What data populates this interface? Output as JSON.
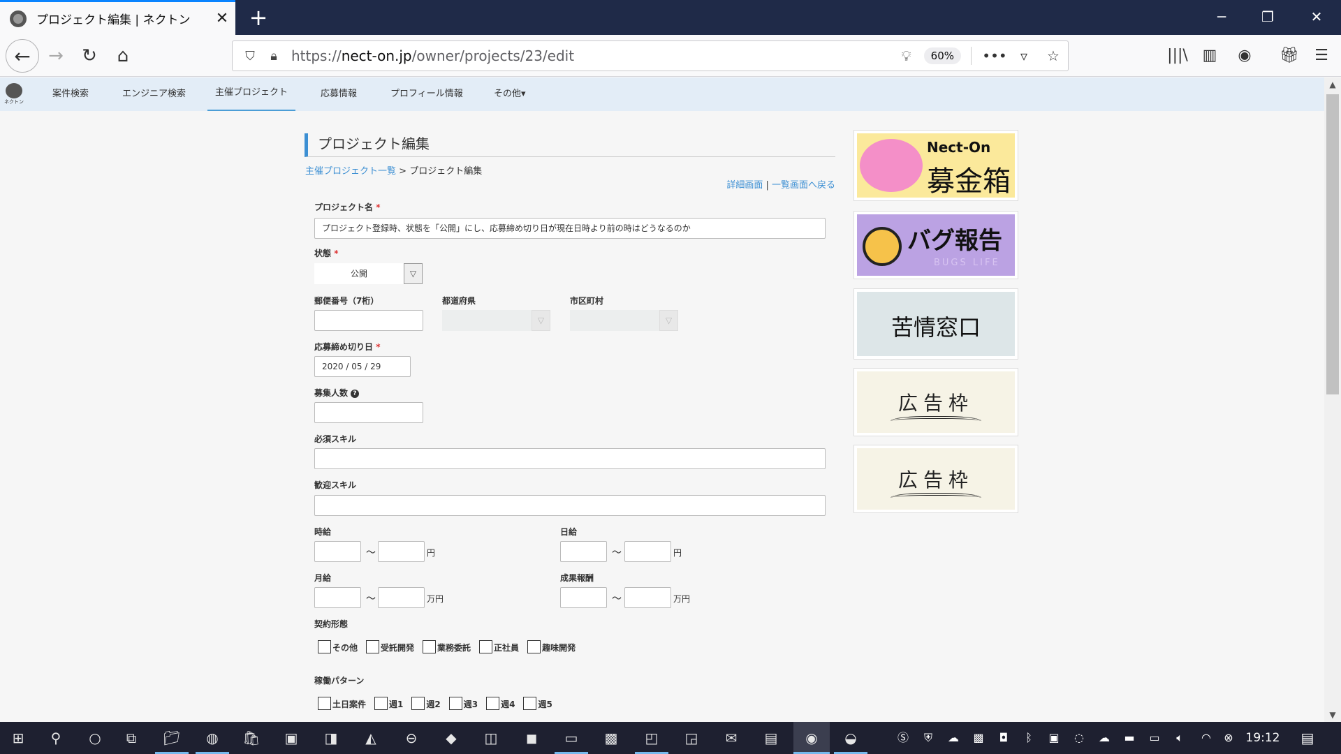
{
  "browser": {
    "tab_title": "プロジェクト編集 | ネクトン",
    "tab_close": "✕",
    "new_tab": "+",
    "url_prefix": "https://",
    "url_domain": "nect-on.jp",
    "url_path": "/owner/projects/23/edit",
    "zoom": "60%",
    "icons": {
      "back": "back-arrow-icon",
      "forward": "forward-arrow-icon",
      "reload": "reload-icon",
      "home": "home-icon",
      "shield": "tracking-shield-icon",
      "lock": "lock-icon",
      "bulb": "lightbulb-icon",
      "more": "more-icon",
      "pocket": "pocket-icon",
      "star": "bookmark-star-icon",
      "library": "library-icon",
      "sidebar": "sidebar-icon",
      "account": "account-icon",
      "gift": "gift-icon",
      "menu": "hamburger-menu-icon"
    }
  },
  "site_nav": {
    "logo_label": "ネクトン",
    "items": [
      {
        "label": "案件検索"
      },
      {
        "label": "エンジニア検索"
      },
      {
        "label": "主催プロジェクト",
        "active": true
      },
      {
        "label": "応募情報"
      },
      {
        "label": "プロフィール情報"
      },
      {
        "label": "その他▾"
      }
    ]
  },
  "page": {
    "title": "プロジェクト編集",
    "breadcrumb": {
      "link": "主催プロジェクト一覧",
      "sep": " > ",
      "current": "プロジェクト編集"
    },
    "links": {
      "detail": "詳細画面",
      "sep": " | ",
      "back": "一覧画面へ戻る"
    }
  },
  "form": {
    "project_name": {
      "label": "プロジェクト名",
      "required": "*",
      "value": "プロジェクト登録時、状態を「公開」にし、応募締め切り日が現在日時より前の時はどうなるのか"
    },
    "status": {
      "label": "状態",
      "required": "*",
      "value": "公開"
    },
    "postal": {
      "label": "郵便番号（7桁）",
      "value": ""
    },
    "prefecture": {
      "label": "都道府県",
      "value": ""
    },
    "city": {
      "label": "市区町村",
      "value": ""
    },
    "deadline": {
      "label": "応募締め切り日",
      "required": "*",
      "value": "2020 / 05 / 29"
    },
    "headcount": {
      "label": "募集人数",
      "help": "?",
      "value": ""
    },
    "required_skills": {
      "label": "必須スキル",
      "value": ""
    },
    "welcome_skills": {
      "label": "歓迎スキル",
      "value": ""
    },
    "hourly": {
      "label": "時給",
      "tilde": "〜",
      "unit": "円"
    },
    "daily": {
      "label": "日給",
      "tilde": "〜",
      "unit": "円"
    },
    "monthly": {
      "label": "月給",
      "tilde": "〜",
      "unit": "万円"
    },
    "reward": {
      "label": "成果報酬",
      "tilde": "〜",
      "unit": "万円"
    },
    "contract": {
      "label": "契約形態",
      "options": [
        "その他",
        "受託開発",
        "業務委託",
        "正社員",
        "趣味開発"
      ]
    },
    "work_pattern": {
      "label": "稼働パターン",
      "options": [
        "土日案件",
        "週1",
        "週2",
        "週3",
        "週4",
        "週5"
      ]
    }
  },
  "banners": {
    "donation": {
      "line1": "Nect-On",
      "line2": "募金箱"
    },
    "bug": {
      "line1": "バグ報告",
      "line2": "BUGS LIFE"
    },
    "complaint": {
      "line1": "苦情窓口"
    },
    "ad1": {
      "line1": "広告枠"
    },
    "ad2": {
      "line1": "広告枠"
    }
  },
  "taskbar": {
    "clock": "19:12"
  }
}
